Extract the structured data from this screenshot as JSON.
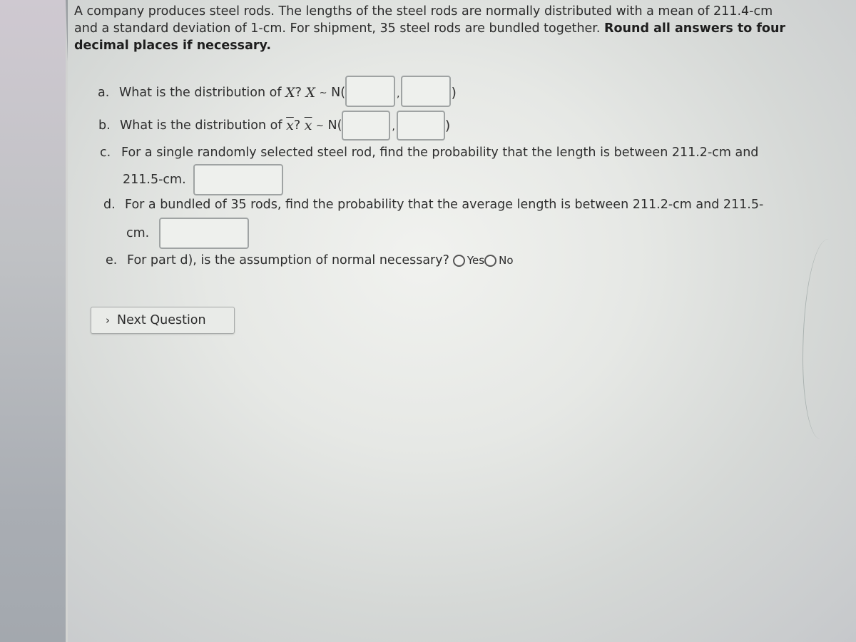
{
  "problem": {
    "intro_text": "A company produces steel rods. The lengths of the steel rods are normally distributed with a mean of 211.4-cm and a standard deviation of 1-cm. For shipment, 35 steel rods are bundled together.",
    "intro_bold": "Round all answers to four decimal places if necessary."
  },
  "questions": {
    "a": {
      "label": "a.",
      "text": "What is the distribution of",
      "var": "X",
      "qmark": "?",
      "var2": "X",
      "tilde": "~",
      "dist": "N(",
      "close": ")",
      "comma": ",",
      "mean_value": "",
      "sd_value": ""
    },
    "b": {
      "label": "b.",
      "text": "What is the distribution of",
      "var": "x",
      "qmark": "?",
      "var2": "x",
      "tilde": "~",
      "dist": "N(",
      "close": ")",
      "comma": ",",
      "mean_value": "",
      "sd_value": ""
    },
    "c": {
      "label": "c.",
      "text_line1": "For a single randomly selected steel rod, find the probability that the length is between 211.2-cm and",
      "text_line2": "211.5-cm.",
      "answer_value": ""
    },
    "d": {
      "label": "d.",
      "text_line1": "For a bundled of 35 rods, find the probability that the average length is between 211.2-cm and 211.5-",
      "text_line2": "cm.",
      "answer_value": ""
    },
    "e": {
      "label": "e.",
      "text": "For part d), is the assumption of normal necessary?",
      "options": [
        "Yes",
        "No"
      ],
      "selected": null
    }
  },
  "next_button": {
    "label": "Next Question",
    "icon": "chevron-right-icon",
    "glyph": "›"
  }
}
